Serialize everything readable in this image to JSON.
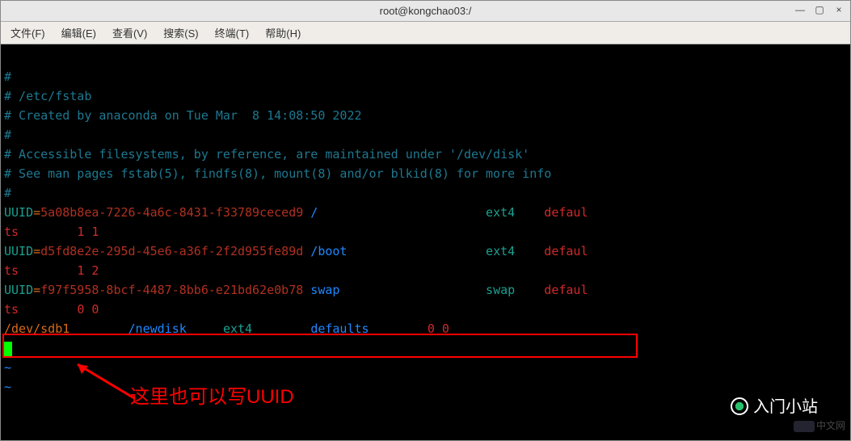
{
  "title": "root@kongchao03:/",
  "window_controls": {
    "min": "—",
    "max": "▢",
    "close": "×"
  },
  "menu": {
    "file": "文件(F)",
    "edit": "编辑(E)",
    "view": "查看(V)",
    "search": "搜索(S)",
    "terminal": "终端(T)",
    "help": "帮助(H)"
  },
  "fstab": {
    "hash": "#",
    "path_line": "# /etc/fstab",
    "created_line": "# Created by anaconda on Tue Mar  8 14:08:50 2022",
    "access_line": "# Accessible filesystems, by reference, are maintained under '/dev/disk'",
    "see_line": "# See man pages fstab(5), findfs(8), mount(8) and/or blkid(8) for more info",
    "entries": [
      {
        "key": "UUID",
        "uuid": "5a08b8ea-7226-4a6c-8431-f33789ceced9",
        "mount": "/",
        "fs": "ext4",
        "opts_head": "defaul",
        "opts_tail": "ts",
        "dump_pass": "1 1"
      },
      {
        "key": "UUID",
        "uuid": "d5fd8e2e-295d-45e6-a36f-2f2d955fe89d",
        "mount": "/boot",
        "fs": "ext4",
        "opts_head": "defaul",
        "opts_tail": "ts",
        "dump_pass": "1 2"
      },
      {
        "key": "UUID",
        "uuid": "f97f5958-8bcf-4487-8bb6-e21bd62e0b78",
        "mount": "swap",
        "fs": "swap",
        "opts_head": "defaul",
        "opts_tail": "ts",
        "dump_pass": "0 0"
      }
    ],
    "new_entry": {
      "device": "/dev/sdb1",
      "mount": "/newdisk",
      "fs": "ext4",
      "opts": "defaults",
      "dump_pass": "0 0"
    },
    "tilde": "~"
  },
  "annotation": "这里也可以写UUID",
  "watermark1": "入门小站",
  "watermark2": "中文网"
}
